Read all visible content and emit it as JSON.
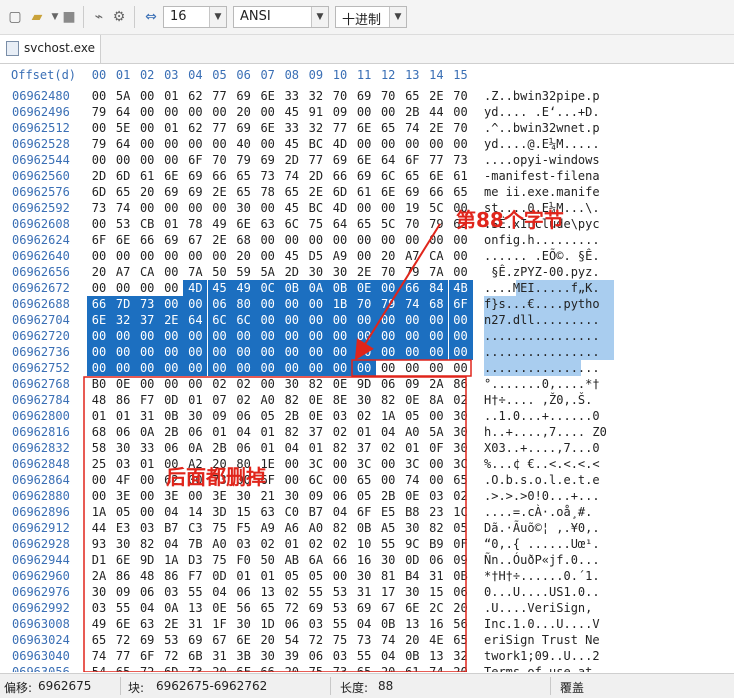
{
  "toolbar": {
    "icons": [
      "new-file-icon",
      "open-folder-icon",
      "save-icon",
      "link-icon",
      "settings-icon",
      "bytes-per-row-icon"
    ],
    "bytes_per_row": "16",
    "encoding": "ANSI",
    "number_format": "十进制"
  },
  "tab": {
    "title": "svchost.exe"
  },
  "header": {
    "offset_label": "Offset(d)",
    "columns": [
      "00",
      "01",
      "02",
      "03",
      "04",
      "05",
      "06",
      "07",
      "08",
      "09",
      "10",
      "11",
      "12",
      "13",
      "14",
      "15"
    ]
  },
  "rows": [
    {
      "offset": "06962480",
      "hex": "00 5A 00 01 62 77 69 6E 33 32 70 69 70 65 2E 70",
      "ascii": ".Z..bwin32pipe.p"
    },
    {
      "offset": "06962496",
      "hex": "79 64 00 00 00 00 20 00 45 91 09 00 00 2B 44 00",
      "ascii": "yd.... .E‘...+D."
    },
    {
      "offset": "06962512",
      "hex": "00 5E 00 01 62 77 69 6E 33 32 77 6E 65 74 2E 70",
      "ascii": ".^..bwin32wnet.p"
    },
    {
      "offset": "06962528",
      "hex": "79 64 00 00 00 00 40 00 45 BC 4D 00 00 00 00 00",
      "ascii": "yd....@.E¼M....."
    },
    {
      "offset": "06962544",
      "hex": "00 00 00 00 6F 70 79 69 2D 77 69 6E 64 6F 77 73",
      "ascii": "....opyi-windows"
    },
    {
      "offset": "06962560",
      "hex": "2D 6D 61 6E 69 66 65 73 74 2D 66 69 6C 65 6E 61",
      "ascii": "-manifest-filena"
    },
    {
      "offset": "06962576",
      "hex": "6D 65 20 69 69 2E 65 78 65 2E 6D 61 6E 69 66 65",
      "ascii": "me ii.exe.manife"
    },
    {
      "offset": "06962592",
      "hex": "73 74 00 00 00 00 30 00 45 BC 4D 00 00 19 5C 00",
      "ascii": "st....0.E¼M...\\."
    },
    {
      "offset": "06962608",
      "hex": "00 53 CB 01 78 49 6E 63 6C 75 64 65 5C 70 79 63",
      "ascii": ".SË.xInclude\\pyc"
    },
    {
      "offset": "06962624",
      "hex": "6F 6E 66 69 67 2E 68 00 00 00 00 00 00 00 00 00",
      "ascii": "onfig.h........."
    },
    {
      "offset": "06962640",
      "hex": "00 00 00 00 00 00 20 00 45 D5 A9 00 20 A7 CA 00",
      "ascii": "...... .EÕ©. §Ê."
    },
    {
      "offset": "06962656",
      "hex": "20 A7 CA 00 7A 50 59 5A 2D 30 30 2E 70 79 7A 00",
      "ascii": " §Ê.zPYZ-00.pyz."
    },
    {
      "offset": "06962672",
      "hex": "00 00 00 00 4D 45 49 0C 0B 0A 0B 0E 00 66 84 4B 00",
      "ascii": "....MEI.....f„K."
    },
    {
      "offset": "06962688",
      "hex": "66 7D 73 00 00 06 80 00 00 00 1B 70 79 74 68 6F",
      "ascii": "f}s...€....pytho"
    },
    {
      "offset": "06962704",
      "hex": "6E 32 37 2E 64 6C 6C 00 00 00 00 00 00 00 00 00",
      "ascii": "n27.dll........."
    },
    {
      "offset": "06962720",
      "hex": "00 00 00 00 00 00 00 00 00 00 00 00 00 00 00 00",
      "ascii": "................"
    },
    {
      "offset": "06962736",
      "hex": "00 00 00 00 00 00 00 00 00 00 00 00 00 00 00 00",
      "ascii": "................"
    },
    {
      "offset": "06962752",
      "hex": "00 00 00 00 00 00 00 00 00 00 00 00 00 00 00 00",
      "ascii": "................"
    },
    {
      "offset": "06962768",
      "hex": "B0 0E 00 00 00 02 02 00 30 82 0E 9D 06 09 2A 86",
      "ascii": "°.......0,....*†"
    },
    {
      "offset": "06962784",
      "hex": "48 86 F7 0D 01 07 02 A0 82 0E 8E 30 82 0E 8A 02",
      "ascii": "H†÷.... ,Ž0,.Š."
    },
    {
      "offset": "06962800",
      "hex": "01 01 31 0B 30 09 06 05 2B 0E 03 02 1A 05 00 30",
      "ascii": "..1.0...+......0"
    },
    {
      "offset": "06962816",
      "hex": "68 06 0A 2B 06 01 04 01 82 37 02 01 04 A0 5A 30",
      "ascii": "h..+....,7.... Z0"
    },
    {
      "offset": "06962832",
      "hex": "58 30 33 06 0A 2B 06 01 04 01 82 37 02 01 0F 30",
      "ascii": "X03..+....,7...0"
    },
    {
      "offset": "06962848",
      "hex": "25 03 01 00 A2 20 80 1E 00 3C 00 3C 00 3C 00 3C",
      "ascii": "%...¢ €..<.<.<.<"
    },
    {
      "offset": "06962864",
      "hex": "00 4F 00 62 00 73 00 6F 00 6C 00 65 00 74 00 65",
      "ascii": ".O.b.s.o.l.e.t.e"
    },
    {
      "offset": "06962880",
      "hex": "00 3E 00 3E 00 3E 30 21 30 09 06 05 2B 0E 03 02",
      "ascii": ".>.>.>0!0...+..."
    },
    {
      "offset": "06962896",
      "hex": "1A 05 00 04 14 3D 15 63 C0 B7 04 6F E5 B8 23 1C",
      "ascii": "....=.cÀ·.oå¸#."
    },
    {
      "offset": "06962912",
      "hex": "44 E3 03 B7 C3 75 F5 A9 A6 A0 82 0B A5 30 82 05",
      "ascii": "Dã.·Ãuõ©¦ ,.¥0,."
    },
    {
      "offset": "06962928",
      "hex": "93 30 82 04 7B A0 03 02 01 02 02 10 55 9C B9 0F",
      "ascii": "“0,.{ ......Uœ¹."
    },
    {
      "offset": "06962944",
      "hex": "D1 6E 9D 1A D3 75 F0 50 AB 6A 66 16 30 0D 06 09",
      "ascii": "Ñn..ÓuðP«jf.0..."
    },
    {
      "offset": "06962960",
      "hex": "2A 86 48 86 F7 0D 01 01 05 05 00 30 81 B4 31 0B",
      "ascii": "*†H†÷......0.´1."
    },
    {
      "offset": "06962976",
      "hex": "30 09 06 03 55 04 06 13 02 55 53 31 17 30 15 06",
      "ascii": "0...U....US1.0.."
    },
    {
      "offset": "06962992",
      "hex": "03 55 04 0A 13 0E 56 65 72 69 53 69 67 6E 2C 20",
      "ascii": ".U....VeriSign, "
    },
    {
      "offset": "06963008",
      "hex": "49 6E 63 2E 31 1F 30 1D 06 03 55 04 0B 13 16 56",
      "ascii": "Inc.1.0...U....V"
    },
    {
      "offset": "06963024",
      "hex": "65 72 69 53 69 67 6E 20 54 72 75 73 74 20 4E 65",
      "ascii": "eriSign Trust Ne"
    },
    {
      "offset": "06963040",
      "hex": "74 77 6F 72 6B 31 3B 30 39 06 03 55 04 0B 13 32",
      "ascii": "twork1;09..U...2"
    },
    {
      "offset": "06963056",
      "hex": "54 65 72 6D 73 20 6F 66 20 75 73 65 20 61 74 20",
      "ascii": "Terms of use at "
    }
  ],
  "callouts": {
    "top": "第88个字节",
    "bottom": "后面都删掉"
  },
  "status": {
    "offset_label": "偏移:",
    "offset_value": "6962675",
    "block_label": "块:",
    "block_value": "6962675-6962762",
    "length_label": "长度:",
    "length_value": "88",
    "mode": "覆盖"
  },
  "colors": {
    "selection": "#1c6fc0",
    "ascii_selection": "#a9cdef",
    "annotation": "#e0251b",
    "offset_text": "#3a6fb5"
  }
}
